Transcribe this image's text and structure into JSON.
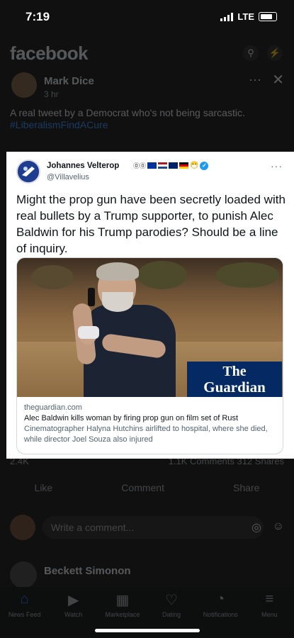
{
  "status_bar": {
    "time": "7:19",
    "network": "LTE"
  },
  "facebook": {
    "logo": "facebook",
    "post": {
      "author": "Mark Dice",
      "time": "3 hr",
      "text": "A real tweet by a Democrat who's not being sarcastic.",
      "hashtag": "#LiberalismFindACure"
    },
    "reactions": "2.4K",
    "counts": "1.1K Comments  312 Shares",
    "actions": [
      "Like",
      "Comment",
      "Share"
    ],
    "comment_placeholder": "Write a comment...",
    "next_post_author": "Beckett Simonon",
    "bottom_nav": [
      "News Feed",
      "Watch",
      "Marketplace",
      "Dating",
      "Notifications",
      "Menu"
    ]
  },
  "tweet": {
    "author_name": "Johannes Velterop",
    "author_handle": "@Villavelius",
    "more": "···",
    "text": "Might the prop gun have been secretly loaded with real bullets by a Trump supporter, to punish Alec Baldwin for his Trump parodies? Should be a line of inquiry.",
    "link_card": {
      "domain": "theguardian.com",
      "title": "Alec Baldwin kills woman by firing prop gun on film set of Rust",
      "description": "Cinematographer Halyna Hutchins airlifted to hospital, where she died, while director Joel Souza also injured",
      "brand_line1": "The",
      "brand_line2": "Guardian"
    }
  },
  "colors": {
    "guardian_blue": "#052962",
    "twitter_blue": "#1d9bf0",
    "fb_blue": "#2d88ff"
  }
}
